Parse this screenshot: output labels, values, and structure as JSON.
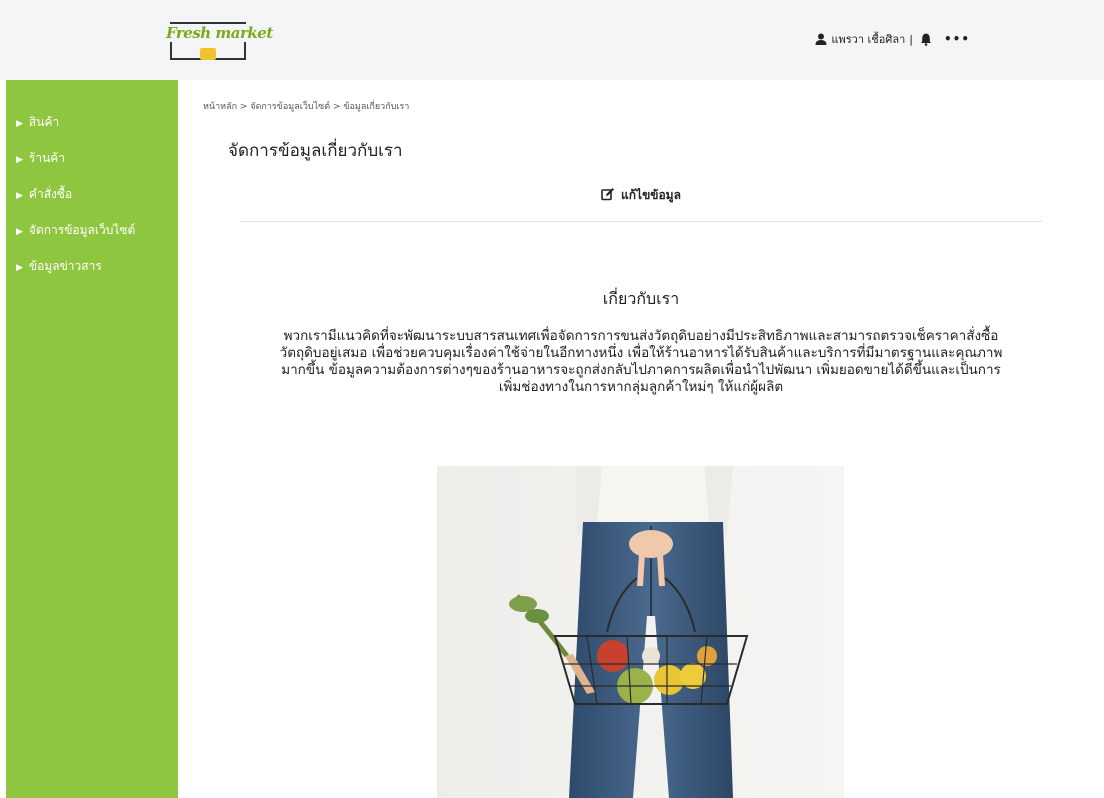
{
  "header": {
    "logo_text": "Fresh market",
    "user_name": "แพรวา เชื้อศิลา",
    "separator": "|",
    "more": "•••"
  },
  "sidebar": {
    "items": [
      {
        "label": "สินค้า"
      },
      {
        "label": "ร้านค้า"
      },
      {
        "label": "คำสั่งซื้อ"
      },
      {
        "label": "จัดการข้อมูลเว็บไซต์"
      },
      {
        "label": "ข้อมูลข่าวสาร"
      }
    ]
  },
  "breadcrumb": "หน้าหลัก > จัดการข้อมูลเว็บไซต์ > ข้อมูลเกี่ยวกับเรา",
  "page_title": "จัดการข้อมูลเกี่ยวกับเรา",
  "edit_label": "แก้ไขข้อมูล",
  "about": {
    "heading": "เกี่ยวกับเรา",
    "body": "พวกเรามีแนวคิดที่จะพัฒนาระบบสารสนเทศเพื่อจัดการการขนส่งวัตถุดิบอย่างมีประสิทธิภาพและสามารถตรวจเช็คราคาสั่งซื้อ วัตถุดิบอยู่เสมอ เพื่อช่วยควบคุมเรื่องค่าใช้จ่ายในอีกทางหนึ่ง เพื่อให้ร้านอาหารได้รับสินค้าและบริการที่มีมาตรฐานและคุณภาพ มากขึ้น ข้อมูลความต้องการต่างๆของร้านอาหารจะถูกส่งกลับไปภาคการผลิตเพื่อนำไปพัฒนา เพิ่มยอดขายได้ดีขึ้นและเป็นการ เพิ่มช่องทางในการหากลุ่มลูกค้าใหม่ๆ ให้แก่ผู้ผลิต"
  },
  "colors": {
    "sidebar": "#8fc63f",
    "header": "#f4f5f7",
    "logo_green": "#7aaa1a"
  }
}
